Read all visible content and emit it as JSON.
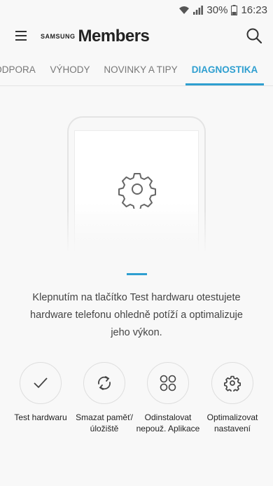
{
  "status": {
    "battery": "30%",
    "time": "16:23"
  },
  "appbar": {
    "brand_small": "SAMSUNG",
    "brand_large": "Members"
  },
  "tabs": [
    {
      "label": "PODPORA"
    },
    {
      "label": "VÝHODY"
    },
    {
      "label": "NOVINKY A TIPY"
    },
    {
      "label": "DIAGNOSTIKA"
    }
  ],
  "main": {
    "description": "Klepnutím na tlačítko Test hardwaru otestujete hardware telefonu ohledně potíží a optimalizuje jeho výkon."
  },
  "actions": [
    {
      "label": "Test hardwaru"
    },
    {
      "label": "Smazat paměť/ úložiště"
    },
    {
      "label": "Odinstalovat nepouž. Aplikace"
    },
    {
      "label": "Optimalizovat nastavení"
    }
  ],
  "colors": {
    "accent": "#2f9fd0",
    "background": "#f8f8f8"
  }
}
